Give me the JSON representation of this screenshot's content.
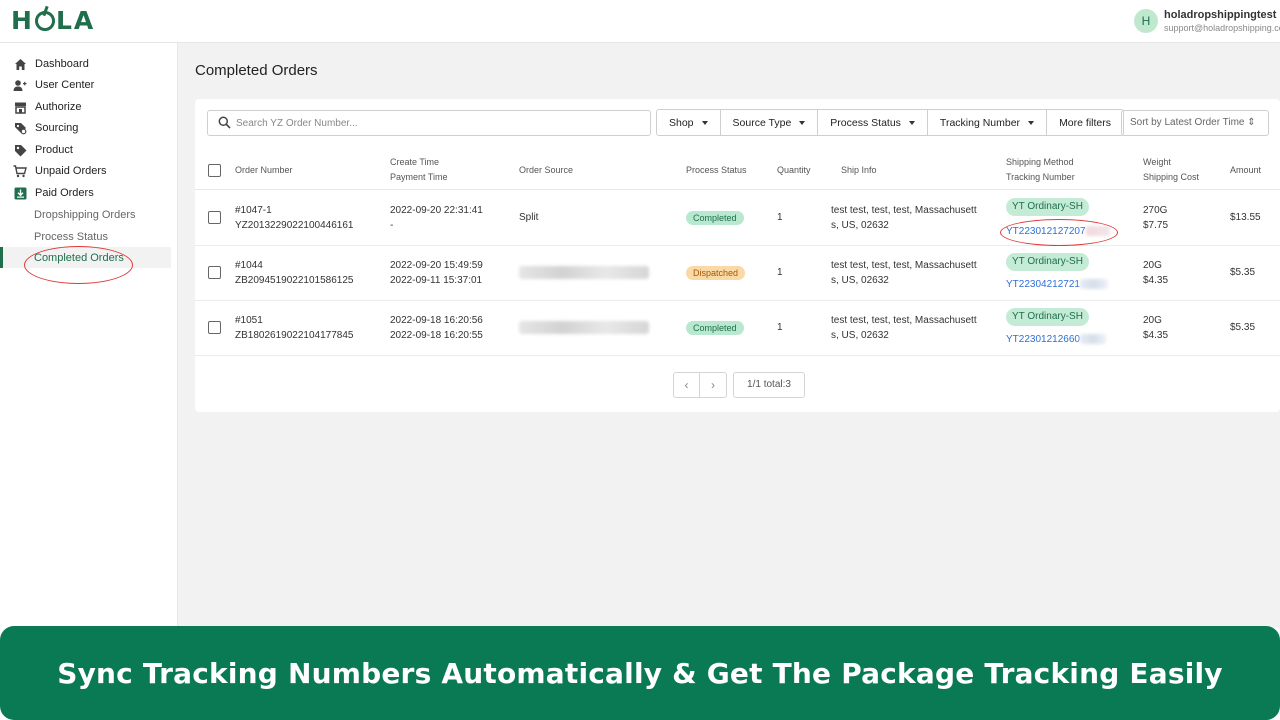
{
  "brand": {
    "logo_text": "HOLA",
    "accent": "#1f6e4c"
  },
  "user": {
    "avatar_letter": "H",
    "name": "holadropshippingtest",
    "email": "support@holadropshipping.com"
  },
  "sidebar": {
    "items": [
      {
        "label": "Dashboard",
        "icon": "home-icon"
      },
      {
        "label": "User Center",
        "icon": "user-add-icon"
      },
      {
        "label": "Authorize",
        "icon": "store-icon"
      },
      {
        "label": "Sourcing",
        "icon": "search-tag-icon"
      },
      {
        "label": "Product",
        "icon": "tag-icon"
      },
      {
        "label": "Unpaid Orders",
        "icon": "cart-icon"
      },
      {
        "label": "Paid Orders",
        "icon": "download-box-icon"
      }
    ],
    "subitems": [
      {
        "label": "Dropshipping Orders"
      },
      {
        "label": "Process Status"
      },
      {
        "label": "Completed Orders",
        "active": true
      }
    ]
  },
  "page": {
    "title": "Completed Orders"
  },
  "search": {
    "placeholder": "Search YZ Order Number..."
  },
  "filters": {
    "shop": "Shop",
    "source_type": "Source Type",
    "process_status": "Process Status",
    "tracking_number": "Tracking Number",
    "more": "More filters"
  },
  "sort": {
    "label": "Sort by Latest Order Time ⇕"
  },
  "table": {
    "headers": {
      "order_number": "Order Number",
      "create_time": "Create Time",
      "payment_time": "Payment Time",
      "order_source": "Order Source",
      "process_status": "Process Status",
      "quantity": "Quantity",
      "ship_info": "Ship Info",
      "shipping_method": "Shipping Method",
      "tracking_number": "Tracking Number",
      "weight": "Weight",
      "shipping_cost": "Shipping Cost",
      "amount": "Amount"
    },
    "rows": [
      {
        "order_no": "#1047-1",
        "yz_no": "YZ2013229022100446161",
        "create_time": "2022-09-20 22:31:41",
        "payment_time": "-",
        "source": "Split",
        "status": "Completed",
        "quantity": "1",
        "ship_line1": "test test, test, test, Massachusett",
        "ship_line2": "s, US, 02632",
        "method": "YT Ordinary-SH",
        "tracking": "YT223012127207",
        "weight": "270G",
        "cost": "$7.75",
        "amount": "$13.55"
      },
      {
        "order_no": "#1044",
        "yz_no": "ZB2094519022101586125",
        "create_time": "2022-09-20 15:49:59",
        "payment_time": "2022-09-11 15:37:01",
        "source": "",
        "status": "Dispatched",
        "quantity": "1",
        "ship_line1": "test test, test, test, Massachusett",
        "ship_line2": "s, US, 02632",
        "method": "YT Ordinary-SH",
        "tracking": "YT22304212721",
        "weight": "20G",
        "cost": "$4.35",
        "amount": "$5.35"
      },
      {
        "order_no": "#1051",
        "yz_no": "ZB1802619022104177845",
        "create_time": "2022-09-18 16:20:56",
        "payment_time": "2022-09-18 16:20:55",
        "source": "",
        "status": "Completed",
        "quantity": "1",
        "ship_line1": "test test, test, test, Massachusett",
        "ship_line2": "s, US, 02632",
        "method": "YT Ordinary-SH",
        "tracking": "YT22301212660",
        "weight": "20G",
        "cost": "$4.35",
        "amount": "$5.35"
      }
    ]
  },
  "pagination": {
    "prev": "‹",
    "next": "›",
    "info": "1/1 total:3"
  },
  "banner": {
    "text": "Sync Tracking Numbers Automatically & Get The Package Tracking Easily",
    "color": "#0a7a55"
  }
}
